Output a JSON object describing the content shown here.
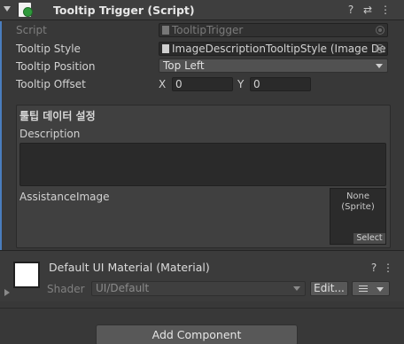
{
  "component": {
    "title": "Tooltip Trigger (Script)",
    "fields": {
      "script": {
        "label": "Script",
        "value": "TooltipTrigger"
      },
      "tooltip_style": {
        "label": "Tooltip Style",
        "value": "ImageDescriptionTooltipStyle (Image De"
      },
      "tooltip_position": {
        "label": "Tooltip Position",
        "value": "Top Left"
      },
      "tooltip_offset": {
        "label": "Tooltip Offset",
        "x_label": "X",
        "x_value": "0",
        "y_label": "Y",
        "y_value": "0"
      }
    },
    "section": {
      "title": "툴팁 데이터 설정",
      "description_label": "Description",
      "description_value": "",
      "image_label": "AssistanceImage",
      "sprite_none": "None",
      "sprite_type": "(Sprite)",
      "select_label": "Select"
    }
  },
  "material": {
    "title": "Default UI Material (Material)",
    "shader_label": "Shader",
    "shader_value": "UI/Default",
    "edit_label": "Edit..."
  },
  "add_component_label": "Add Component",
  "colors": {
    "accent": "#4a7dbd",
    "background": "#383838",
    "header": "#3e3e3e"
  },
  "icons": [
    "chevron-down-icon",
    "script-icon",
    "help-icon",
    "presets-icon",
    "more-icon",
    "object-icon",
    "target-icon",
    "list-icon"
  ]
}
